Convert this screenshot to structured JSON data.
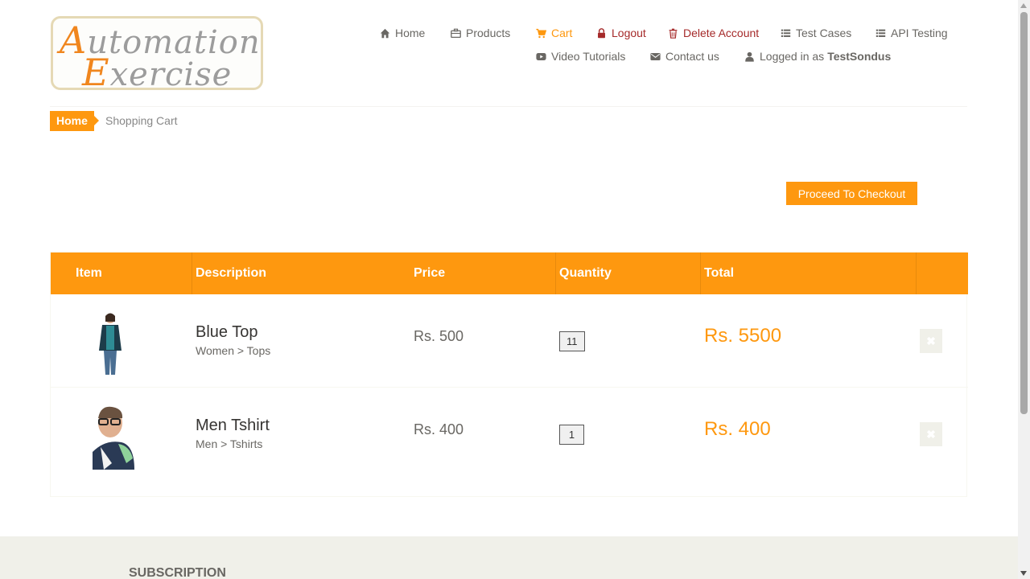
{
  "logo": {
    "line1_cap": "A",
    "line1_rest": "utomation",
    "line2_cap": "E",
    "line2_rest": "xercise"
  },
  "nav": {
    "home": "Home",
    "products": "Products",
    "cart": "Cart",
    "logout": "Logout",
    "delete_account": "Delete Account",
    "test_cases": "Test Cases",
    "api_testing": "API Testing",
    "video_tutorials": "Video Tutorials",
    "contact_us": "Contact us",
    "logged_in_prefix": "Logged in as",
    "username": "TestSondus"
  },
  "breadcrumb": {
    "home": "Home",
    "current": "Shopping Cart"
  },
  "checkout_button": "Proceed To Checkout",
  "table": {
    "headers": [
      "Item",
      "Description",
      "Price",
      "Quantity",
      "Total"
    ],
    "rows": [
      {
        "name": "Blue Top",
        "category": "Women > Tops",
        "price": "Rs. 500",
        "quantity": "11",
        "total": "Rs. 5500",
        "image": "woman-blue-top"
      },
      {
        "name": "Men Tshirt",
        "category": "Men > Tshirts",
        "price": "Rs. 400",
        "quantity": "1",
        "total": "Rs. 400",
        "image": "man-tshirt"
      }
    ],
    "delete_glyph": "✖"
  },
  "footer": {
    "subscription_title": "Subscription"
  },
  "colors": {
    "accent": "#fe980f",
    "danger": "#a52a2a",
    "footer_bg": "#f0f0e9"
  }
}
